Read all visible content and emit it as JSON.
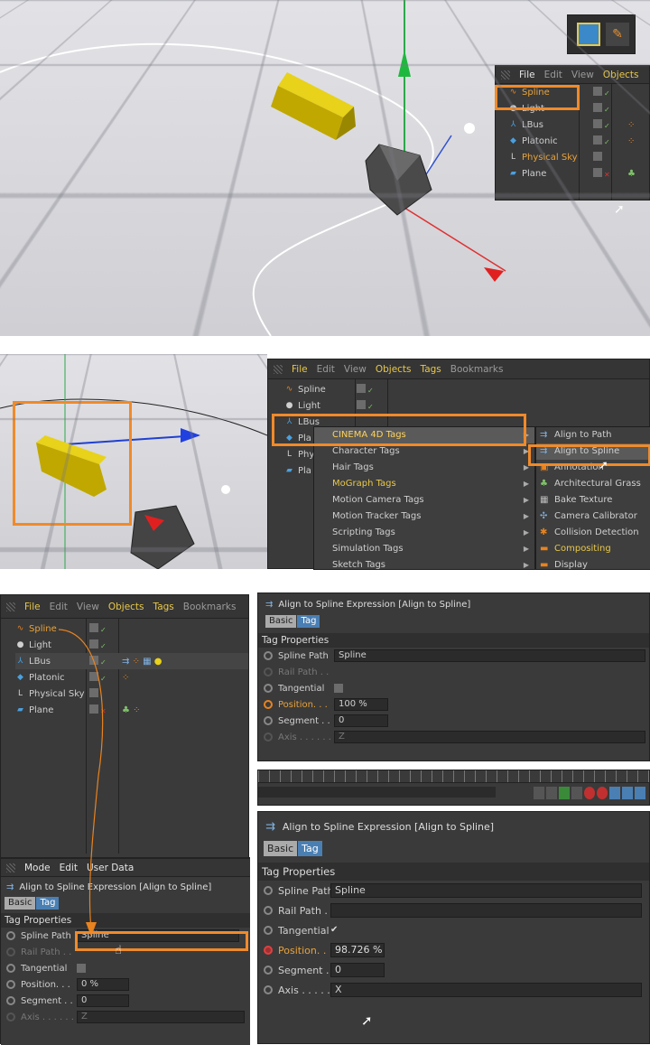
{
  "panel1": {
    "menu": {
      "file": "File",
      "edit": "Edit",
      "view": "View",
      "objects": "Objects"
    },
    "objects": [
      {
        "name": "Spline",
        "icon": "spline-icon"
      },
      {
        "name": "Light",
        "icon": "light-icon"
      },
      {
        "name": "LBus",
        "icon": "null-icon"
      },
      {
        "name": "Platonic",
        "icon": "platonic-icon"
      },
      {
        "name": "Physical Sky",
        "icon": "sky-icon"
      },
      {
        "name": "Plane",
        "icon": "plane-icon"
      }
    ]
  },
  "panel2": {
    "menu": {
      "file": "File",
      "edit": "Edit",
      "view": "View",
      "objects": "Objects",
      "tags": "Tags",
      "bookmarks": "Bookmarks"
    },
    "objects": [
      "Spline",
      "Light",
      "LBus",
      "Pla",
      "Phy",
      "Pla"
    ],
    "tag_menu": [
      "CINEMA 4D Tags",
      "Character Tags",
      "Hair Tags",
      "MoGraph Tags",
      "Motion Camera Tags",
      "Motion Tracker Tags",
      "Scripting Tags",
      "Simulation Tags",
      "Sketch Tags"
    ],
    "sub_menu": [
      "Align to Path",
      "Align to Spline",
      "Annotation",
      "Architectural Grass",
      "Bake Texture",
      "Camera Calibrator",
      "Collision Detection",
      "Compositing",
      "Display"
    ]
  },
  "panel3": {
    "menu": {
      "file": "File",
      "edit": "Edit",
      "view": "View",
      "objects": "Objects",
      "tags": "Tags",
      "bookmarks": "Bookmarks"
    },
    "objects": [
      "Spline",
      "Light",
      "LBus",
      "Platonic",
      "Physical Sky",
      "Plane"
    ],
    "attr_menu": {
      "mode": "Mode",
      "edit": "Edit",
      "user_data": "User Data"
    },
    "title": "Align to Spline Expression [Align to Spline]",
    "tabs": {
      "basic": "Basic",
      "tag": "Tag"
    },
    "section": "Tag Properties",
    "props": {
      "spline_path": "Spline Path",
      "rail_path": "Rail Path . .",
      "tangential": "Tangential",
      "position": "Position. . .",
      "segment": "Segment . .",
      "axis": "Axis . . . . . ."
    },
    "values": {
      "spline_path": "Spline",
      "position": "0 %",
      "segment": "0",
      "axis": "Z"
    }
  },
  "panel4": {
    "title": "Align to Spline Expression [Align to Spline]",
    "tabs": {
      "basic": "Basic",
      "tag": "Tag"
    },
    "section": "Tag Properties",
    "props": {
      "spline_path": "Spline Path",
      "rail_path": "Rail Path . .",
      "tangential": "Tangential",
      "position": "Position. . .",
      "segment": "Segment . .",
      "axis": "Axis . . . . . ."
    },
    "values": {
      "spline_path": "Spline",
      "position": "100 %",
      "segment": "0",
      "axis": "Z"
    }
  },
  "panel5": {
    "title": "Align to Spline Expression [Align to Spline]",
    "tabs": {
      "basic": "Basic",
      "tag": "Tag"
    },
    "section": "Tag Properties",
    "props": {
      "spline_path": "Spline Path",
      "rail_path": "Rail Path . .",
      "tangential": "Tangential",
      "position": "Position. . .",
      "segment": "Segment . .",
      "axis": "Axis . . . . . ."
    },
    "values": {
      "spline_path": "Spline",
      "tangential_mark": "✔",
      "position": "98.726 %",
      "segment": "0",
      "axis": "X"
    }
  },
  "colors": {
    "highlight": "#f08a2a",
    "active_text": "#e8a23a",
    "menu_yellow": "#e8c84a"
  }
}
